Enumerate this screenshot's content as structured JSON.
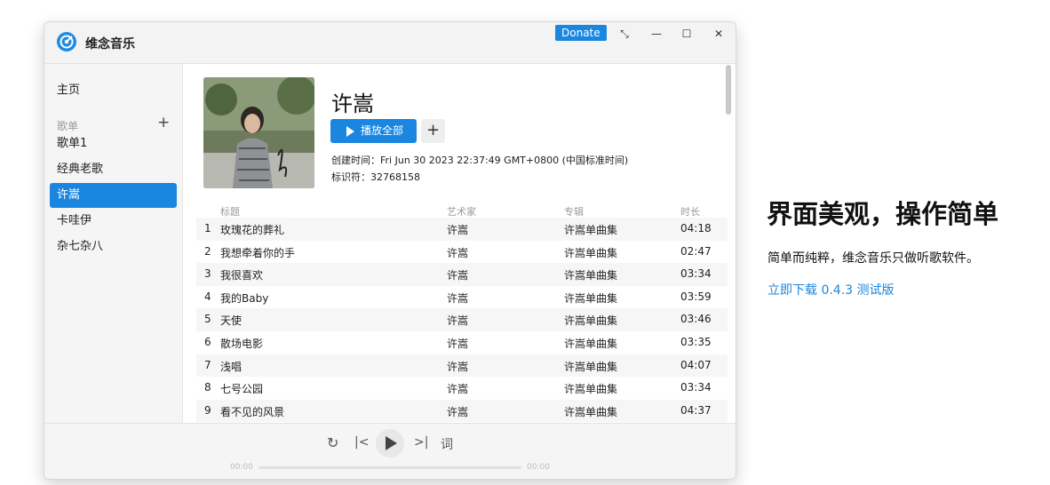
{
  "app": {
    "title": "维念音乐",
    "donate": "Donate"
  },
  "window_controls": {
    "restore": "⤡",
    "minimize": "—",
    "maximize": "☐",
    "close": "✕"
  },
  "sidebar": {
    "home": "主页",
    "playlists_label": "歌单",
    "add": "+",
    "items": [
      "歌单1",
      "经典老歌",
      "许嵩",
      "卡哇伊",
      "杂七杂八"
    ],
    "active_index": 2
  },
  "playlist": {
    "title": "许嵩",
    "play_all": "播放全部",
    "add": "+",
    "created": "创建时间：Fri Jun 30 2023 22:37:49 GMT+0800 (中国标准时间)",
    "id": "标识符：32768158"
  },
  "table": {
    "headers": {
      "title": "标题",
      "artist": "艺术家",
      "album": "专辑",
      "duration": "时长"
    },
    "rows": [
      {
        "n": "1",
        "title": "玫瑰花的葬礼",
        "artist": "许嵩",
        "album": "许嵩单曲集",
        "duration": "04:18"
      },
      {
        "n": "2",
        "title": "我想牵着你的手",
        "artist": "许嵩",
        "album": "许嵩单曲集",
        "duration": "02:47"
      },
      {
        "n": "3",
        "title": "我很喜欢",
        "artist": "许嵩",
        "album": "许嵩单曲集",
        "duration": "03:34"
      },
      {
        "n": "4",
        "title": "我的Baby",
        "artist": "许嵩",
        "album": "许嵩单曲集",
        "duration": "03:59"
      },
      {
        "n": "5",
        "title": "天使",
        "artist": "许嵩",
        "album": "许嵩单曲集",
        "duration": "03:46"
      },
      {
        "n": "6",
        "title": "散场电影",
        "artist": "许嵩",
        "album": "许嵩单曲集",
        "duration": "03:35"
      },
      {
        "n": "7",
        "title": "浅唱",
        "artist": "许嵩",
        "album": "许嵩单曲集",
        "duration": "04:07"
      },
      {
        "n": "8",
        "title": "七号公园",
        "artist": "许嵩",
        "album": "许嵩单曲集",
        "duration": "03:34"
      },
      {
        "n": "9",
        "title": "看不见的风景",
        "artist": "许嵩",
        "album": "许嵩单曲集",
        "duration": "04:37"
      }
    ]
  },
  "player": {
    "loop": "↻",
    "prev": "|<",
    "next": ">|",
    "lyrics": "词",
    "time_current": "00:00",
    "time_total": "00:00",
    "progress": 0
  },
  "promo": {
    "title": "界面美观，操作简单",
    "subtitle": "简单而纯粹，维念音乐只做听歌软件。",
    "link": "立即下载 0.4.3 测试版"
  },
  "colors": {
    "accent": "#1a86e0"
  }
}
